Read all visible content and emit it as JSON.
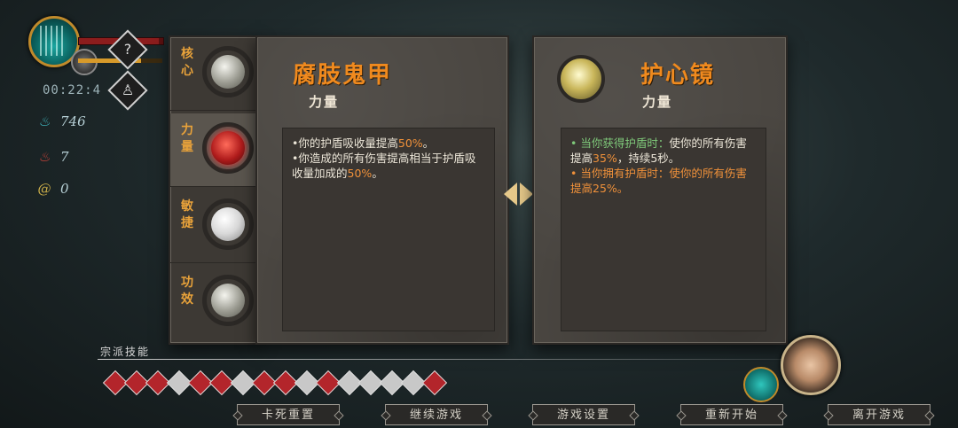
{
  "hud": {
    "timer": "00:22:4",
    "hp_fraction": 0.95,
    "xp_fraction": 0.75,
    "help_symbol": "?",
    "resources": [
      {
        "icon": "soul-flame-icon",
        "value": "746",
        "color": "#3fb8c0"
      },
      {
        "icon": "red-flame-icon",
        "value": "7",
        "color": "#d0443a"
      },
      {
        "icon": "yellow-swirl-icon",
        "value": "0",
        "color": "#d0b24a"
      }
    ]
  },
  "tabs": [
    {
      "label": "核心",
      "orb": "silver"
    },
    {
      "label": "力量",
      "orb": "red",
      "selected": true
    },
    {
      "label": "敏捷",
      "orb": "pearl"
    },
    {
      "label": "功效",
      "orb": "silver"
    }
  ],
  "left_item": {
    "name": "腐肢鬼甲",
    "category": "力量",
    "lines": [
      {
        "prefix": "•你的护盾吸收量提高",
        "hl": "50%",
        "suffix": "。"
      },
      {
        "prefix": "•你造成的所有伤害提高相当于护盾吸收量加成的",
        "hl": "50%",
        "suffix": "。"
      }
    ]
  },
  "right_item": {
    "name": "护心镜",
    "category": "力量",
    "line1_green": "• 当你获得护盾时：",
    "line1_text": "使你的所有伤害提高",
    "line1_hl": "35%",
    "line1_tail": "，持续5秒。",
    "line2_orange": "• 当你拥有护盾时：使你的所有伤害提高25%。"
  },
  "skills": {
    "label": "宗派技能",
    "count": 16,
    "colors": [
      "#b3252b",
      "#b3252b",
      "#b3252b",
      "#c8c8c8",
      "#b3252b",
      "#b3252b",
      "#c8c8c8",
      "#b3252b",
      "#b3252b",
      "#c8c8c8",
      "#b3252b",
      "#c8c8c8",
      "#c8c8c8",
      "#c8c8c8",
      "#c8c8c8",
      "#b3252b"
    ]
  },
  "buttons": [
    "卡死重置",
    "继续游戏",
    "游戏设置",
    "重新开始",
    "离开游戏"
  ]
}
